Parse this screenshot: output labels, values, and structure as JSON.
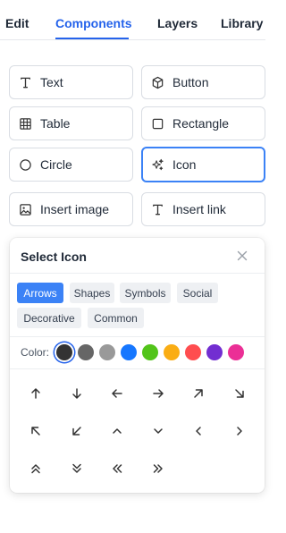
{
  "tabs": [
    {
      "label": "Edit",
      "active": false
    },
    {
      "label": "Components",
      "active": true
    },
    {
      "label": "Layers",
      "active": false
    },
    {
      "label": "Library",
      "active": false
    }
  ],
  "components": [
    {
      "label": "Text",
      "icon": "text-icon",
      "selected": false
    },
    {
      "label": "Button",
      "icon": "cube-icon",
      "selected": false
    },
    {
      "label": "Table",
      "icon": "table-icon",
      "selected": false
    },
    {
      "label": "Rectangle",
      "icon": "square-icon",
      "selected": false
    },
    {
      "label": "Circle",
      "icon": "circle-icon",
      "selected": false
    },
    {
      "label": "Icon",
      "icon": "sparkles-icon",
      "selected": true
    },
    {
      "label": "Insert image",
      "icon": "image-icon",
      "selected": false
    },
    {
      "label": "Insert link",
      "icon": "text-icon",
      "selected": false
    }
  ],
  "icon_picker": {
    "title": "Select Icon",
    "close_icon": "close-icon",
    "categories": [
      {
        "label": "Arrows",
        "active": true
      },
      {
        "label": "Shapes",
        "active": false
      },
      {
        "label": "Symbols",
        "active": false
      },
      {
        "label": "Social",
        "active": false
      },
      {
        "label": "Decorative",
        "active": false
      },
      {
        "label": "Common",
        "active": false
      }
    ],
    "color_label": "Color:",
    "colors": [
      {
        "hex": "#333333",
        "selected": true
      },
      {
        "hex": "#666666",
        "selected": false
      },
      {
        "hex": "#999999",
        "selected": false
      },
      {
        "hex": "#1677ff",
        "selected": false
      },
      {
        "hex": "#52c41a",
        "selected": false
      },
      {
        "hex": "#faad14",
        "selected": false
      },
      {
        "hex": "#ff4d4f",
        "selected": false
      },
      {
        "hex": "#722ed1",
        "selected": false
      },
      {
        "hex": "#eb2f96",
        "selected": false
      }
    ],
    "icons": [
      "arrow-up-icon",
      "arrow-down-icon",
      "arrow-left-icon",
      "arrow-right-icon",
      "arrow-up-right-icon",
      "arrow-down-right-icon",
      "arrow-up-left-icon",
      "arrow-down-left-icon",
      "chevron-up-icon",
      "chevron-down-icon",
      "chevron-left-icon",
      "chevron-right-icon",
      "chevrons-up-icon",
      "chevrons-down-icon",
      "chevrons-left-icon",
      "chevrons-right-icon"
    ]
  },
  "theme": {
    "accent": "#2563eb",
    "icon_color": "#333333"
  }
}
